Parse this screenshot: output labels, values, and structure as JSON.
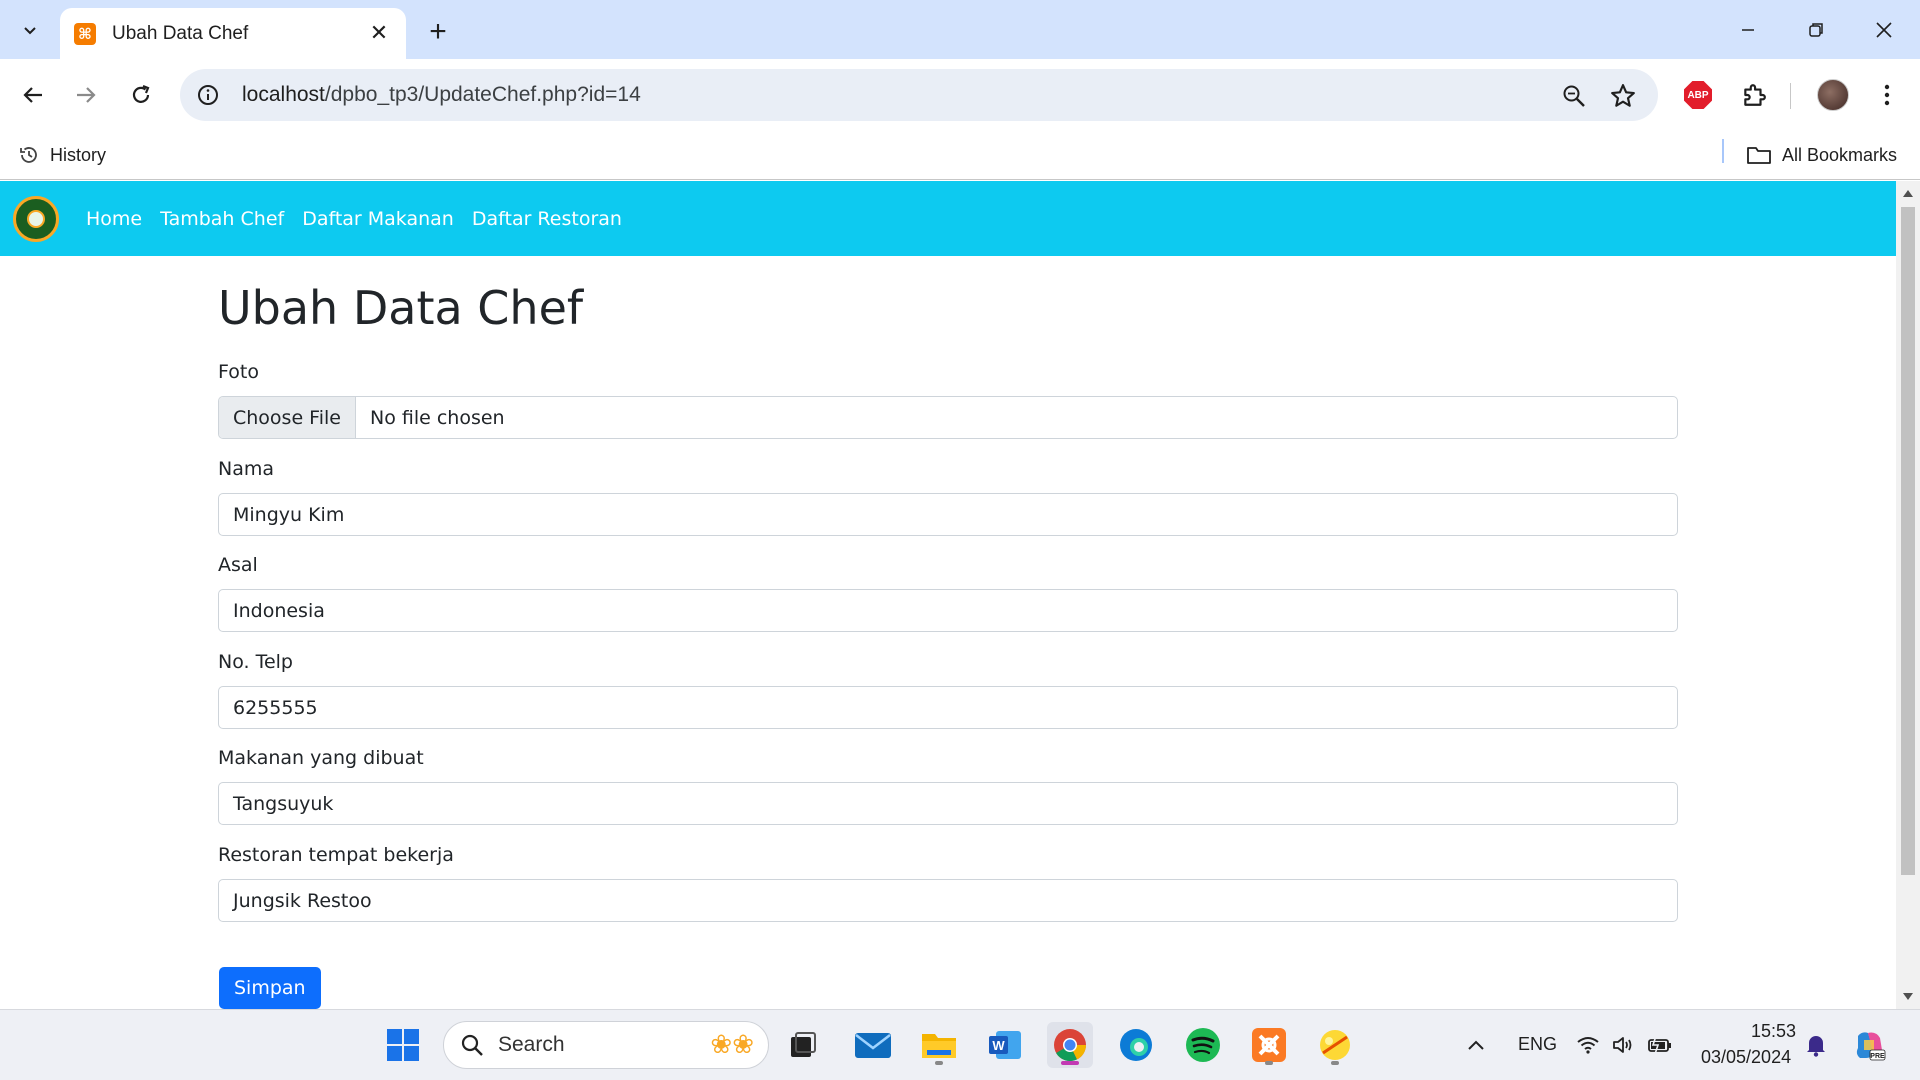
{
  "browser": {
    "tab_title": "Ubah Data Chef",
    "url_host": "localhost",
    "url_path": "/dpbo_tp3/UpdateChef.php?id=14",
    "bookmarks": {
      "history_label": "History",
      "all_bookmarks_label": "All Bookmarks"
    },
    "abp_label": "ABP"
  },
  "navbar": {
    "links": [
      "Home",
      "Tambah Chef",
      "Daftar Makanan",
      "Daftar Restoran"
    ]
  },
  "page": {
    "title": "Ubah Data Chef",
    "fields": {
      "foto": {
        "label": "Foto",
        "button": "Choose File",
        "status": "No file chosen"
      },
      "nama": {
        "label": "Nama",
        "value": "Mingyu Kim"
      },
      "asal": {
        "label": "Asal",
        "value": "Indonesia"
      },
      "telp": {
        "label": "No. Telp",
        "value": "6255555"
      },
      "makanan": {
        "label": "Makanan yang dibuat",
        "value": "Tangsuyuk"
      },
      "restoran": {
        "label": "Restoran tempat bekerja",
        "value": "Jungsik Restoo"
      }
    },
    "submit_label": "Simpan"
  },
  "taskbar": {
    "search_label": "Search",
    "language": "ENG",
    "time": "15:53",
    "date": "03/05/2024"
  },
  "colors": {
    "navbar": "#0dcaf0",
    "primary_button": "#0d6efd",
    "tabbar": "#d3e3fd"
  }
}
